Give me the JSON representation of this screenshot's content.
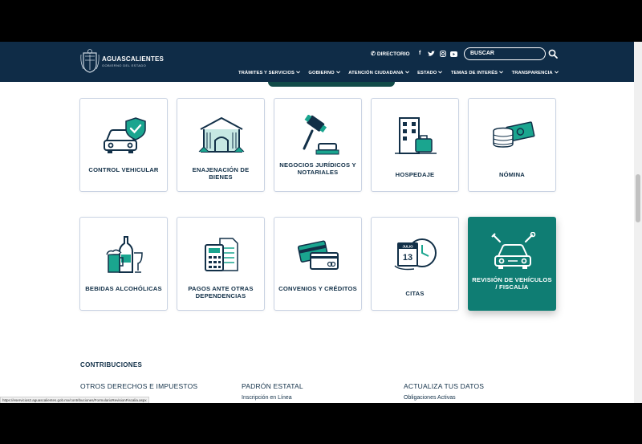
{
  "header": {
    "logo_name": "AGUASCALIENTES",
    "logo_sub": "GOBIERNO DEL ESTADO",
    "directorio": "DIRECTORIO",
    "social": [
      "f",
      "t",
      "ig",
      "yt"
    ],
    "search_placeholder": "BUSCAR",
    "menu": [
      "TRÁMITES Y SERVICIOS",
      "GOBIERNO",
      "ATENCIÓN CIUDADANA",
      "ESTADO",
      "TEMAS DE INTERÉS",
      "TRANSPARENCIA"
    ]
  },
  "tiles": [
    {
      "label": "CONTROL VEHICULAR",
      "icon": "car-shield-icon"
    },
    {
      "label": "ENAJENACIÓN DE BIENES",
      "icon": "building-icon"
    },
    {
      "label": "NEGOCIOS JURÍDICOS Y NOTARIALES",
      "icon": "gavel-icon"
    },
    {
      "label": "HOSPEDAJE",
      "icon": "hotel-luggage-icon"
    },
    {
      "label": "NÓMINA",
      "icon": "money-icon"
    },
    {
      "label": "BEBIDAS ALCOHÓLICAS",
      "icon": "bottle-beer-icon"
    },
    {
      "label": "PAGOS ANTE OTRAS DEPENDENCIAS",
      "icon": "calculator-document-icon"
    },
    {
      "label": "CONVENIOS Y CRÉDITOS",
      "icon": "credit-cards-icon"
    },
    {
      "label": "CITAS",
      "icon": "calendar-clock-icon",
      "calendar_month": "JULIO",
      "calendar_day": "13"
    },
    {
      "label": "REVISIÓN DE VEHÍCULOS / FISCALÍA",
      "icon": "car-wrench-icon",
      "active": true
    }
  ],
  "footer": {
    "contrib_title": "CONTRIBUCIONES",
    "columns": [
      {
        "title": "OTROS DERECHOS E IMPUESTOS",
        "link": ""
      },
      {
        "title": "PADRÓN ESTATAL",
        "link": "Inscripción en Línea"
      },
      {
        "title": "ACTUALIZA TUS DATOS",
        "link": "Obligaciones Activas"
      }
    ]
  },
  "status_url": "https://eservicios2.aguascalientes.gob.mx/contribuciones/FormularioRevisionFiscalia.aspx",
  "colors": {
    "header_bg": "#0f2c47",
    "accent_teal": "#0f7d73",
    "icon_teal": "#1aa58f",
    "icon_navy": "#123048",
    "tile_border": "#c9d3e3"
  }
}
